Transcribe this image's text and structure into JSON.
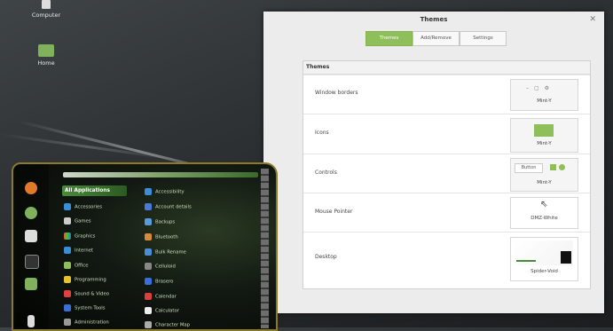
{
  "desktop": {
    "icons": [
      {
        "label": "Computer"
      },
      {
        "label": "Home"
      }
    ]
  },
  "window": {
    "title": "Themes",
    "tabs": [
      {
        "label": "Themes",
        "active": true
      },
      {
        "label": "Add/Remove",
        "active": false
      },
      {
        "label": "Settings",
        "active": false
      }
    ],
    "section_title": "Themes",
    "rows": [
      {
        "label": "Window borders",
        "value": "Mint-Y"
      },
      {
        "label": "Icons",
        "value": "Mint-Y"
      },
      {
        "label": "Controls",
        "value": "Mint-Y",
        "button_text": "Button"
      },
      {
        "label": "Mouse Pointer",
        "value": "DMZ-White"
      },
      {
        "label": "Desktop",
        "value": "Spider-Void"
      }
    ]
  },
  "menu": {
    "all_applications": "All Applications",
    "categories": [
      "Accessories",
      "Games",
      "Graphics",
      "Internet",
      "Office",
      "Programming",
      "Sound & Video",
      "System Tools",
      "Administration"
    ],
    "apps": [
      "Accessibility",
      "Account details",
      "Backups",
      "Bluetooth",
      "Bulk Rename",
      "Celluloid",
      "Brasero",
      "Calendar",
      "Calculator",
      "Character Map"
    ],
    "colors": {
      "accent": "#8fbf5a",
      "menu_border": "#8a7a2a"
    }
  }
}
